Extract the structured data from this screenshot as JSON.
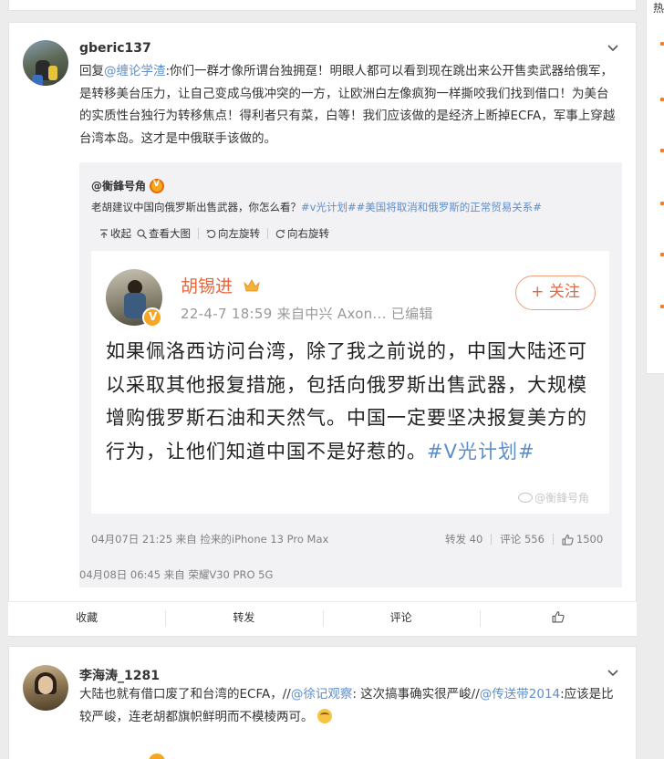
{
  "side": {
    "top_char": "热"
  },
  "post": {
    "username": "gberic137",
    "text_prefix": "回复",
    "mention": "@缠论学渣",
    "text_body": ":你们一群才像所谓台独拥趸！明眼人都可以看到现在跳出来公开售卖武器给俄军，是转移美台压力，让自己变成乌俄冲突的一方，让欧洲白左像疯狗一样撕咬我们找到借口！为美台的实质性台独行为转移焦点！得利者只有菜，白等！我们应该做的是经济上断掉ECFA，军事上穿越台湾本岛。这才是中俄联手该做的。",
    "source": "04月08日 06:45  来自 荣耀V30 PRO 5G"
  },
  "repost": {
    "author": "@衡鋒号角",
    "text": "老胡建议中国向俄罗斯出售武器，你怎么看？",
    "hashtag1": "#v光计划#",
    "hashtag2": "#美国将取消和俄罗斯的正常贸易关系#",
    "toolbar": {
      "collapse": "收起",
      "view_large": "查看大图",
      "rotate_left": "向左旋转",
      "rotate_right": "向右旋转"
    },
    "screenshot": {
      "name": "胡锡进",
      "meta": "22-4-7 18:59  来自中兴 Axon...  已编辑",
      "follow": "+ 关注",
      "body": "如果佩洛西访问台湾，除了我之前说的，中国大陆还可以采取其他报复措施，包括向俄罗斯出售武器，大规模增购俄罗斯石油和天然气。中国一定要坚决报复美方的行为，让他们知道中国不是好惹的。",
      "hashtag": "#V光计划#",
      "watermark": "@衡鋒号角"
    },
    "source": "04月07日 21:25 来自 捡来的iPhone 13 Pro Max",
    "reposts": "转发 40",
    "comments": "评论 556",
    "likes": "1500"
  },
  "actions": {
    "favorite": "收藏",
    "forward": "转发",
    "comment": "评论"
  },
  "next_post": {
    "username": "李海涛_1281",
    "text_a": "大陆也就有借口废了和台湾的ECFA，//",
    "mention1": "@徐记观察",
    "text_b": ": 这次搞事确实很严峻//",
    "mention2": "@传送带2014",
    "text_c": ":应该是比较严峻，连老胡都旗帜鲜明而不模棱两可。"
  }
}
